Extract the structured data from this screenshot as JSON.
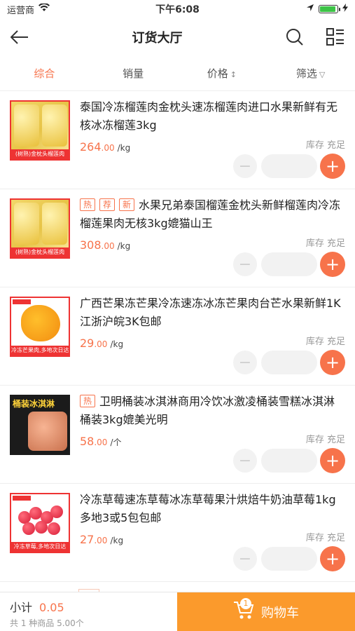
{
  "status_bar": {
    "carrier": "运营商",
    "time": "下午6:08",
    "battery_level": 0.9
  },
  "header": {
    "title": "订货大厅"
  },
  "tabs": [
    {
      "label": "综合",
      "active": true
    },
    {
      "label": "销量"
    },
    {
      "label": "价格",
      "symbol": "↕"
    },
    {
      "label": "筛选",
      "symbol": "▽"
    }
  ],
  "products": [
    {
      "name": "泰国冷冻榴莲肉金枕头速冻榴莲肉进口水果新鲜有无核冰冻榴莲3kg",
      "tags": [],
      "price_int": "264",
      "price_dec": ".00",
      "unit": "/kg",
      "stock": "库存 充足",
      "image_caption": "(树熟)金枕头榴莲肉"
    },
    {
      "name": "水果兄弟泰国榴莲金枕头新鲜榴莲肉冷冻榴莲果肉无核3kg媲猫山王",
      "tags": [
        "热",
        "荐",
        "新"
      ],
      "price_int": "308",
      "price_dec": ".00",
      "unit": "/kg",
      "stock": "库存 充足",
      "image_caption": "(树熟)金枕头榴莲肉"
    },
    {
      "name": "广西芒果冻芒果冷冻速冻冰冻芒果肉台芒水果新鲜1K江浙沪皖3K包邮",
      "tags": [],
      "price_int": "29",
      "price_dec": ".00",
      "unit": "/kg",
      "stock": "库存 充足",
      "image_caption": "冷冻芒果肉,多地次日达"
    },
    {
      "name": "卫明桶装冰淇淋商用冷饮冰激凌桶装雪糕冰淇淋桶装3kg媲美光明",
      "tags": [
        "热"
      ],
      "price_int": "58",
      "price_dec": ".00",
      "unit": "/个",
      "stock": "库存 充足",
      "image_caption": "桶装冰淇淋"
    },
    {
      "name": "冷冻草莓速冻草莓冰冻草莓果汁烘焙牛奶油草莓1kg多地3或5包包邮",
      "tags": [],
      "price_int": "27",
      "price_dec": ".00",
      "unit": "/kg",
      "stock": "库存 充足",
      "image_caption": "冷冻草莓,多地次日达"
    }
  ],
  "footer": {
    "subtotal_label": "小计",
    "subtotal_amount": "0.05",
    "summary": "共 1 种商品 5.00个",
    "cart_label": "购物车",
    "cart_count": "1"
  },
  "colors": {
    "accent": "#f7734b",
    "cart": "#fb9a2c"
  }
}
